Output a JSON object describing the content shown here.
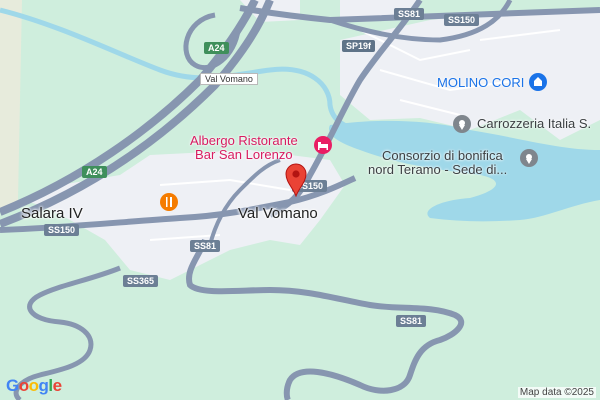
{
  "map": {
    "places": {
      "val_vomano_main": "Val Vomano",
      "salara_iv": "Salara IV",
      "molino_cori": "MOLINO CORI",
      "carrozzeria": "Carrozzeria Italia S.",
      "consorzio_line1": "Consorzio di bonifica",
      "consorzio_line2": "nord Teramo - Sede di...",
      "albergo_line1": "Albergo Ristorante",
      "albergo_line2": "Bar San Lorenzo",
      "val_vomano_area": "Val Vomano"
    },
    "shields": {
      "ss81_top": "SS81",
      "ss150_top": "SS150",
      "sp19f": "SP19f",
      "a24_upper": "A24",
      "a24_lower": "A24",
      "ss150_pin": "SS150",
      "ss150_left": "SS150",
      "ss81_mid": "SS81",
      "ss365": "SS365",
      "ss81_right": "SS81"
    },
    "icons": {
      "restaurant": "restaurant-icon",
      "hotel": "hotel-icon",
      "molino": "shop-icon",
      "pin": "location-pin-icon",
      "generic": "place-icon"
    },
    "colors": {
      "land": "#cfeedd",
      "urban": "#eef0f5",
      "water": "#9fd8e9",
      "road": "#8796b0",
      "pin": "#ea4335"
    },
    "footer": {
      "attribution": "Map data ©2025",
      "logo": "Google"
    }
  }
}
